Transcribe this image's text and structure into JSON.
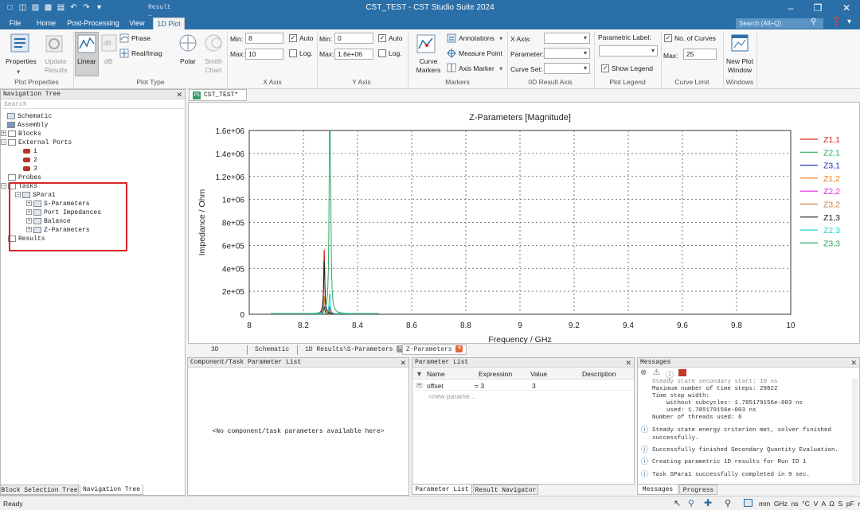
{
  "window": {
    "title": "CST_TEST - CST Studio Suite 2024",
    "context_tab": "Result T..."
  },
  "menu_tabs": [
    "File",
    "Home",
    "Post-Processing",
    "View",
    "1D Plot"
  ],
  "search_placeholder": "Search (Alt+Q)",
  "ribbon": {
    "plot_properties": {
      "properties": "Properties",
      "update_results": "Update Results",
      "group": "Plot Properties"
    },
    "plot_type": {
      "linear": "Linear",
      "db": "dB",
      "phase": "Phase",
      "realimag": "Real/Imag",
      "polar": "Polar",
      "smith": "Smith Chart",
      "group": "Plot Type"
    },
    "x_axis": {
      "min_label": "Min:",
      "min": "8",
      "max_label": "Max:",
      "max": "10",
      "auto": "Auto",
      "log": "Log.",
      "group": "X Axis"
    },
    "y_axis": {
      "min_label": "Min:",
      "min": "0",
      "max_label": "Max:",
      "max": "1.6e+06",
      "auto": "Auto",
      "log": "Log.",
      "group": "Y Axis"
    },
    "markers": {
      "curve_markers": "Curve Markers",
      "annotations": "Annotations",
      "measure_point": "Measure Point",
      "axis_marker": "Axis Marker",
      "group": "Markers"
    },
    "od_axis": {
      "x_axis": "X Axis:",
      "parameter": "Parameter:",
      "curve_set": "Curve Set:",
      "group": "0D Result Axis"
    },
    "legend": {
      "param_label": "Parametric Label:",
      "show_legend": "Show Legend",
      "group": "Plot Legend"
    },
    "curve_limit": {
      "no_curves": "No. of Curves",
      "max_label": "Max:",
      "max": "25",
      "group": "Curve Limit"
    },
    "windows": {
      "new_plot": "New Plot Window",
      "group": "Windows"
    }
  },
  "nav": {
    "title": "Navigation Tree",
    "search": "Search",
    "items": [
      "Schematic",
      "Assembly",
      "Blocks",
      "External Ports",
      "1",
      "2",
      "3",
      "Probes",
      "Tasks",
      "SPara1",
      "S-Parameters",
      "Port Impedances",
      "Balance",
      "Z-Parameters",
      "Results"
    ],
    "bottom_tabs": [
      "Block Selection Tree",
      "Navigation Tree"
    ]
  },
  "doc_tab": "CST_TEST*",
  "view_tabs": [
    "3D",
    "Schematic",
    "1D Results\\S-Parameters",
    "Z-Parameters"
  ],
  "comp_panel": {
    "title": "Component/Task Parameter List",
    "empty": "<No component/task parameters available here>"
  },
  "param_panel": {
    "title": "Parameter List",
    "headers": [
      "Name",
      "Expression",
      "Value",
      "Description"
    ],
    "row": {
      "name": "offset",
      "expr": "= 3",
      "value": "3"
    },
    "new_param": "<new parame...",
    "tabs": [
      "Parameter List",
      "Result Navigator"
    ]
  },
  "messages": {
    "title": "Messages",
    "log": [
      "Steady state secondary start: 10 ns",
      "Maximum number of time steps: 29822",
      "Time step width:",
      "    without subcycles: 1.785179156e-003 ns",
      "    used: 1.785179156e-003 ns",
      "Number of threads used: 6"
    ],
    "items": [
      "Steady state energy criterion met, solver finished successfully.",
      "Successfully finished Secondary Quantity Evaluation.",
      "Creating parametric 1D results for Run ID 1",
      "Task SPara1 successfully completed in 9 sec."
    ],
    "tabs": [
      "Messages",
      "Progress"
    ]
  },
  "status": {
    "left": "Ready",
    "units": "mm  GHz  ns  °C  V  A  Ω  S  pF  nH"
  },
  "colors": {
    "accent": "#2a6fa8",
    "highlight": "#d9242a"
  },
  "chart_data": {
    "type": "line",
    "title": "Z-Parameters [Magnitude]",
    "xlabel": "Frequency / GHz",
    "ylabel": "Impedance / Ohm",
    "xlim": [
      8,
      10
    ],
    "ylim": [
      0,
      1600000
    ],
    "x_ticks": [
      "8",
      "8.2",
      "8.4",
      "8.6",
      "8.8",
      "9",
      "9.2",
      "9.4",
      "9.6",
      "9.8",
      "10"
    ],
    "y_ticks": [
      "0",
      "2e+05",
      "4e+05",
      "6e+05",
      "8e+05",
      "1e+06",
      "1.2e+06",
      "1.4e+06",
      "1.6e+06"
    ],
    "grid": true,
    "legend_position": "right",
    "series": [
      {
        "name": "Z1,1",
        "color": "#e02020",
        "peaks": [
          [
            8.277,
            560000
          ]
        ]
      },
      {
        "name": "Z2,1",
        "color": "#22b14c",
        "peaks": [
          [
            8.277,
            150000
          ],
          [
            8.297,
            60000
          ]
        ]
      },
      {
        "name": "Z3,1",
        "color": "#2030c0",
        "peaks": [
          [
            8.277,
            60000
          ],
          [
            8.297,
            30000
          ]
        ]
      },
      {
        "name": "Z1,2",
        "color": "#f08020",
        "peaks": [
          [
            8.277,
            150000
          ]
        ]
      },
      {
        "name": "Z2,2",
        "color": "#e020e0",
        "peaks": [
          [
            8.297,
            50000
          ]
        ]
      },
      {
        "name": "Z3,2",
        "color": "#d08040",
        "peaks": [
          [
            8.297,
            40000
          ]
        ]
      },
      {
        "name": "Z1,3",
        "color": "#202020",
        "peaks": [
          [
            8.277,
            460000
          ]
        ]
      },
      {
        "name": "Z2,3",
        "color": "#20d0d0",
        "peaks": [
          [
            8.297,
            180000
          ]
        ]
      },
      {
        "name": "Z3,3",
        "color": "#2ea860",
        "peaks": [
          [
            8.297,
            1490000
          ],
          [
            8.3,
            860000
          ]
        ]
      }
    ]
  }
}
